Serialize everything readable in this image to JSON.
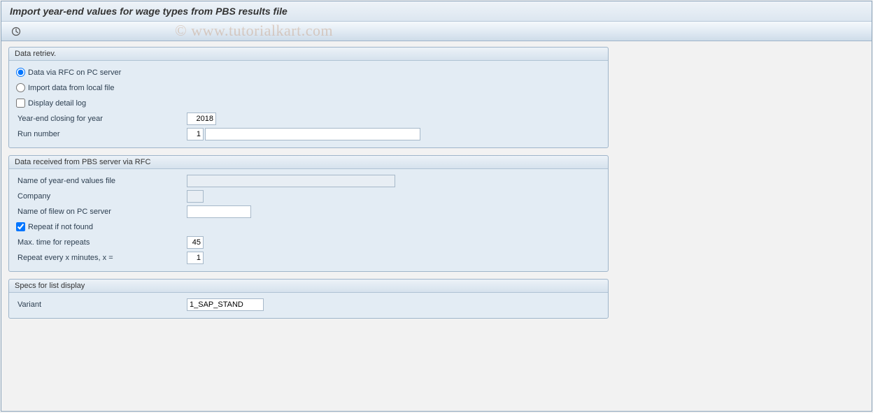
{
  "header": {
    "title": "Import year-end values for wage types from PBS results file"
  },
  "watermark": "© www.tutorialkart.com",
  "groups": {
    "retrieval": {
      "title": "Data retriev.",
      "radio_rfc": "Data via RFC on PC server",
      "radio_local": "Import data from local file",
      "check_log": "Display detail log",
      "year_label": "Year-end closing for year",
      "year_value": "2018",
      "run_label": "Run number",
      "run_value": "1",
      "run_desc": ""
    },
    "rfc": {
      "title": "Data received from PBS server via RFC",
      "file_label": "Name of year-end values file",
      "file_value": "",
      "company_label": "Company",
      "company_value": "",
      "pcfile_label": "Name of filew on PC server",
      "pcfile_value": "",
      "repeat_label": "Repeat if not found",
      "maxtime_label": "Max. time for repeats",
      "maxtime_value": "45",
      "every_label": "Repeat every x minutes, x =",
      "every_value": "1"
    },
    "specs": {
      "title": "Specs for list display",
      "variant_label": "Variant",
      "variant_value": "1_SAP_STAND"
    }
  }
}
